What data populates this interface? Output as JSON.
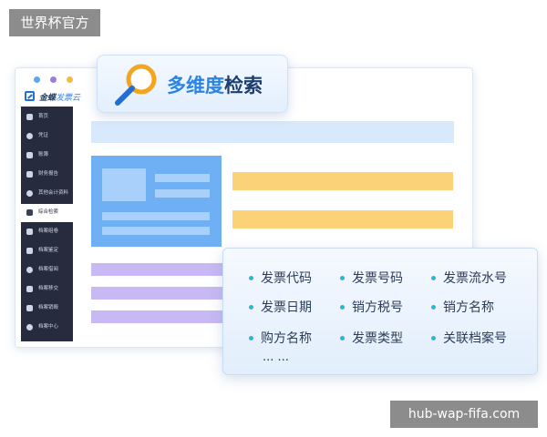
{
  "watermarks": {
    "top_left": "世界杯官方",
    "bottom_right": "hub-wap-fifa.com"
  },
  "app": {
    "brand_main": "金蝶",
    "brand_sub": "发票云"
  },
  "sidebar": {
    "items": [
      {
        "label": "首页",
        "active": false
      },
      {
        "label": "凭证",
        "active": false
      },
      {
        "label": "账簿",
        "active": false
      },
      {
        "label": "财务报告",
        "active": false
      },
      {
        "label": "其他会计资料",
        "active": false
      },
      {
        "label": "综合检索",
        "active": true
      },
      {
        "label": "档案组卷",
        "active": false
      },
      {
        "label": "档案鉴定",
        "active": false
      },
      {
        "label": "档案借阅",
        "active": false
      },
      {
        "label": "档案移交",
        "active": false
      },
      {
        "label": "档案销毁",
        "active": false
      },
      {
        "label": "档案中心",
        "active": false
      }
    ]
  },
  "search_header": {
    "title_highlight": "多维度",
    "title_rest": "检索",
    "icon": "magnifier-icon"
  },
  "fields": {
    "items": [
      "发票代码",
      "发票号码",
      "发票流水号",
      "发票日期",
      "销方税号",
      "销方名称",
      "购方名称",
      "发票类型",
      "关联档案号"
    ],
    "more": "... ..."
  },
  "colors": {
    "accent_blue": "#2a84e6",
    "title_dark": "#1d3f6e",
    "sidebar_bg": "#262b3d",
    "card_blue": "#6fb0f4",
    "bar_yellow": "#fbd277",
    "bar_purple": "#c8b8f3",
    "bullet_cyan": "#29b6d6"
  }
}
